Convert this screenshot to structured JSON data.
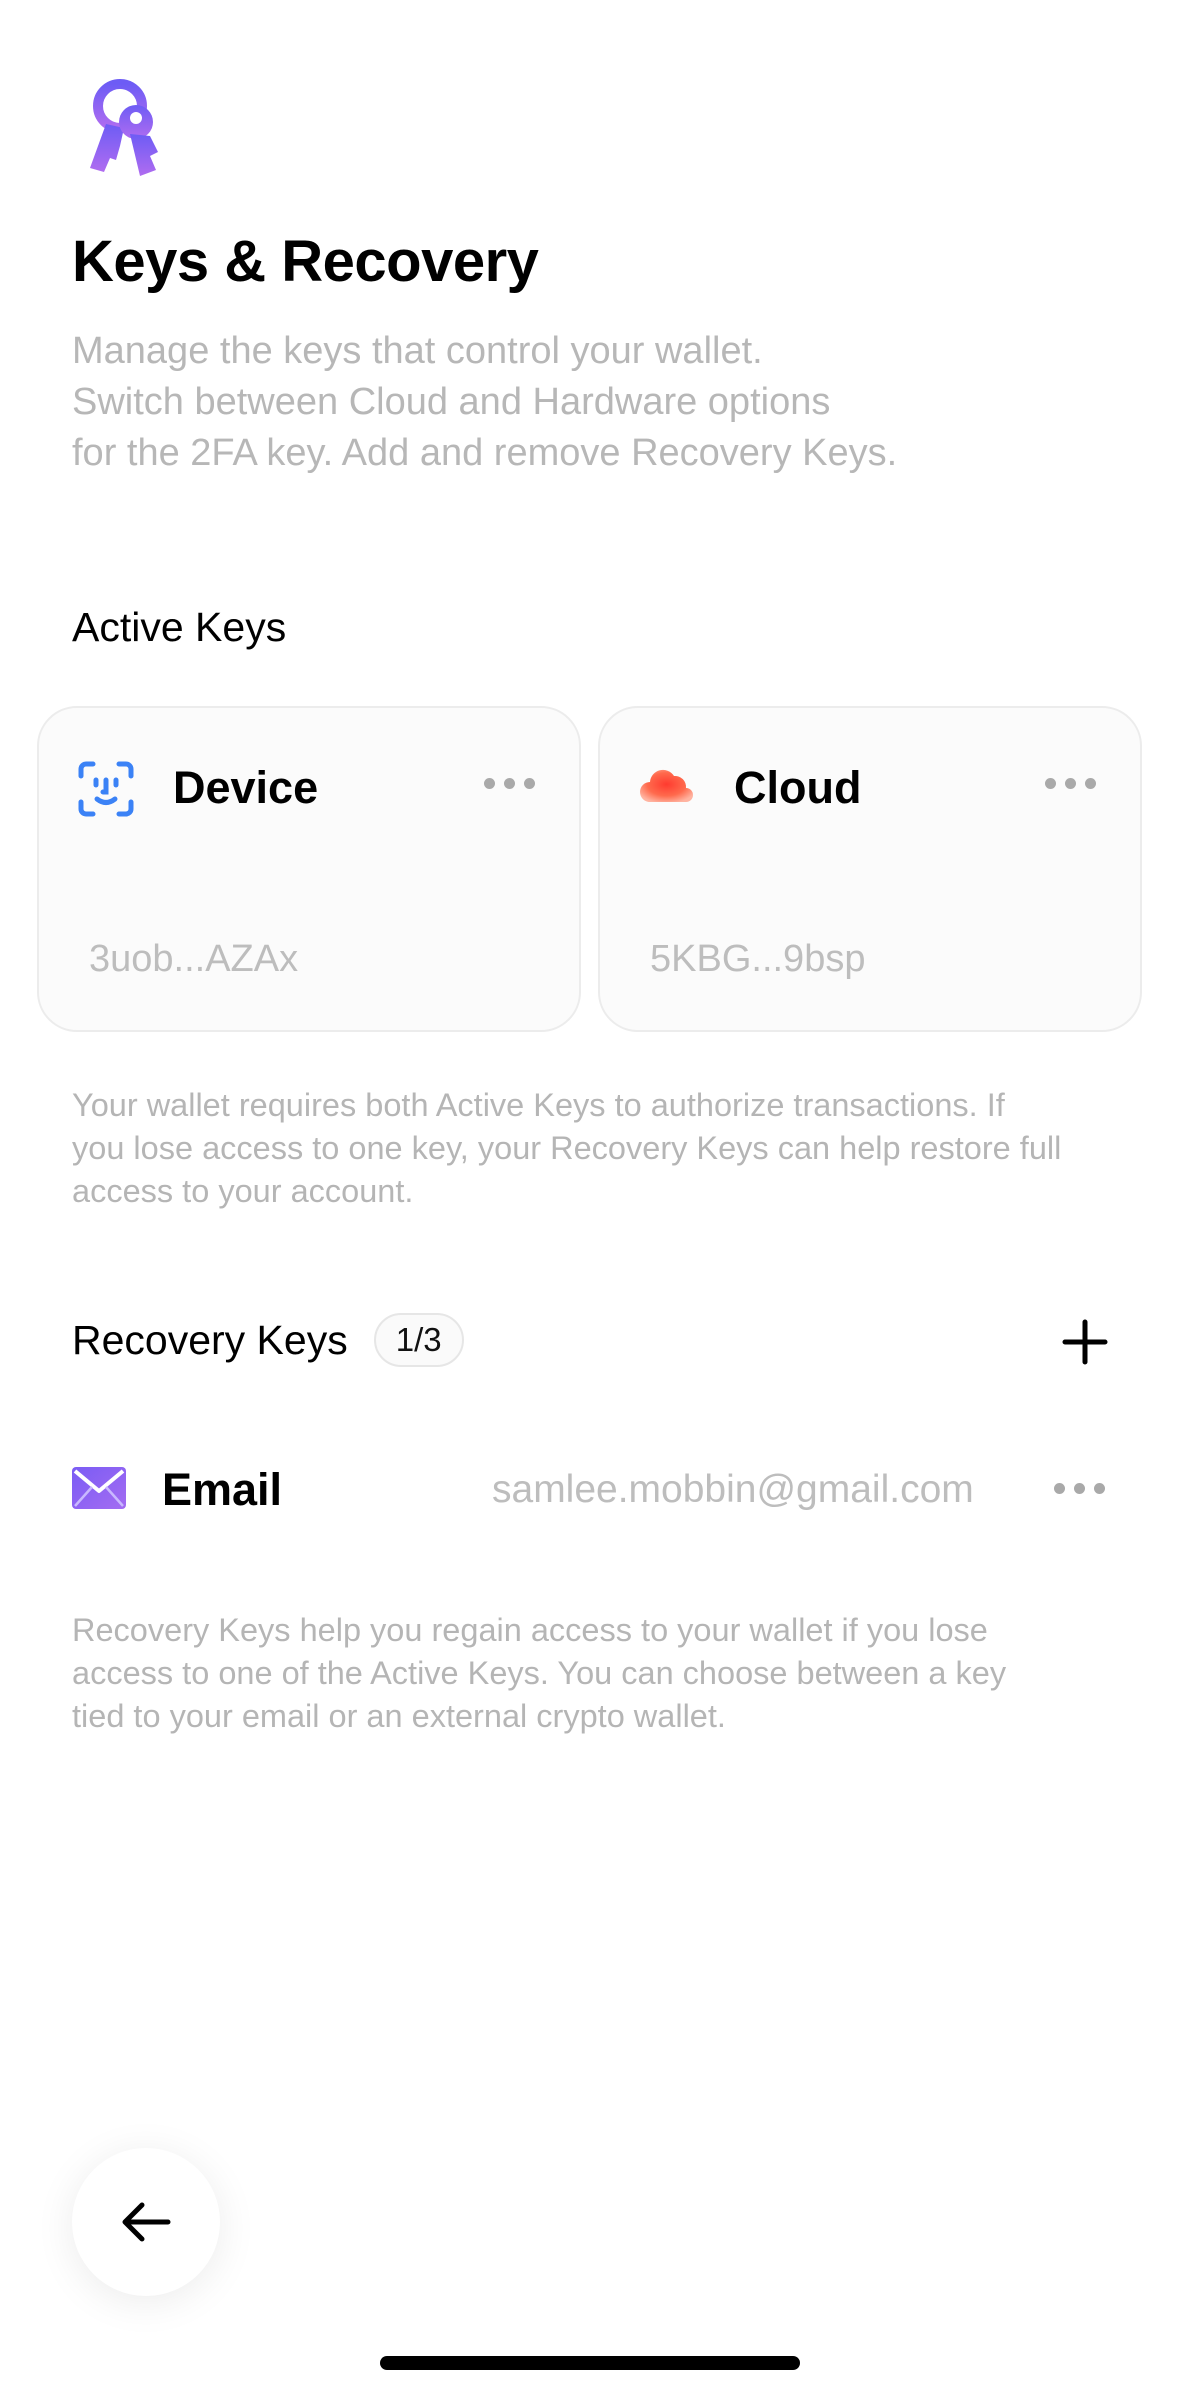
{
  "header": {
    "icon": "keys-icon",
    "title": "Keys & Recovery",
    "subtitle_lines": [
      "Manage the keys that control your wallet.",
      "Switch between Cloud and Hardware options",
      "for the 2FA key. Add and remove Recovery Keys."
    ]
  },
  "active_keys": {
    "title": "Active Keys",
    "cards": [
      {
        "name": "Device",
        "address": "3uob...AZAx",
        "icon": "face-id-icon"
      },
      {
        "name": "Cloud",
        "address": "5KBG...9bsp",
        "icon": "cloud-icon"
      }
    ],
    "note_lines": [
      "Your wallet requires both Active Keys to authorize transactions. If",
      "you lose access to one key, your Recovery Keys can help restore full",
      "access to your account."
    ]
  },
  "recovery_keys": {
    "title": "Recovery Keys",
    "count": "1/3",
    "items": [
      {
        "name": "Email",
        "value": "samlee.mobbin@gmail.com",
        "icon": "email-icon"
      }
    ],
    "note_lines": [
      "Recovery Keys help you regain access to your wallet if you lose",
      "access to one of the Active Keys. You can choose between a key",
      "tied to your email or an external crypto wallet."
    ]
  },
  "colors": {
    "accent_purple": "#8b5cf6",
    "device_icon_blue": "#3b82f6",
    "cloud_icon_orange": "#ff5a3c",
    "secondary_text": "#b5b5b5"
  }
}
